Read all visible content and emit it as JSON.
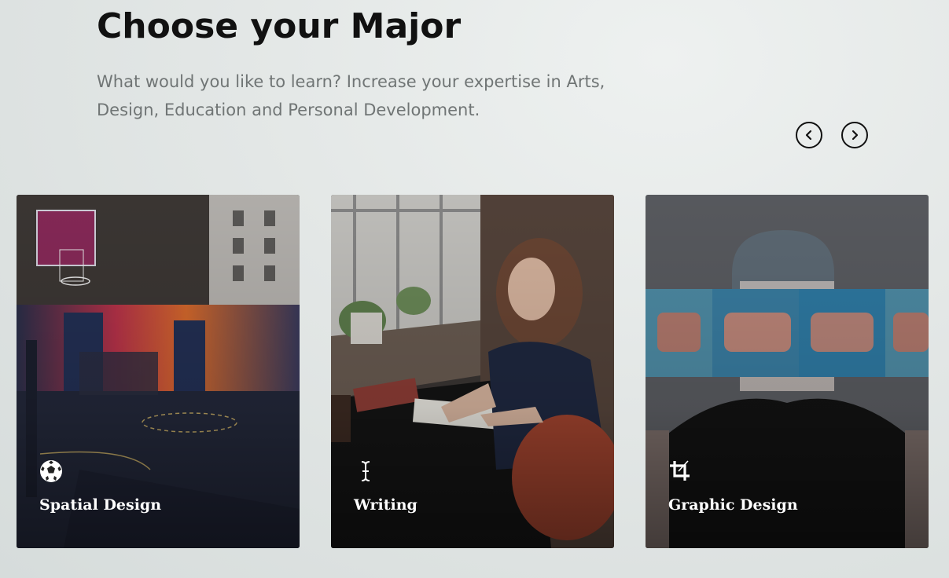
{
  "header": {
    "title": "Choose your Major",
    "subtitle": "What would you like to learn? Increase your expertise in Arts, Design, Education and Personal Development."
  },
  "carousel": {
    "prev_icon": "chevron-left-icon",
    "next_icon": "chevron-right-icon"
  },
  "majors": [
    {
      "label": "Spatial Design",
      "icon": "soccer-ball-icon"
    },
    {
      "label": "Writing",
      "icon": "text-cursor-icon"
    },
    {
      "label": "Graphic Design",
      "icon": "crop-icon"
    }
  ]
}
